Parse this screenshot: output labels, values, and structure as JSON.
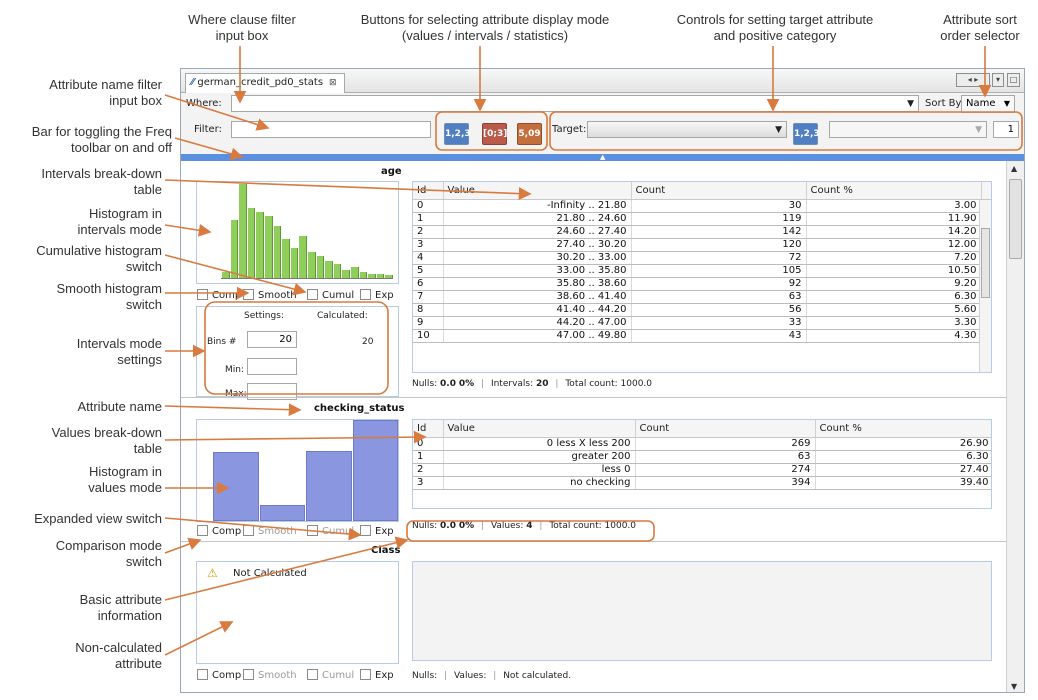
{
  "annotations_top": {
    "where_filter": "Where clause filter\ninput box",
    "mode_buttons": "Buttons for selecting attribute display mode\n(values / intervals / statistics)",
    "target_controls": "Controls for setting target attribute\nand positive category",
    "sort_selector": "Attribute sort\norder selector"
  },
  "annotations_left": {
    "name_filter": "Attribute name filter\ninput box",
    "freq_toggle": "Bar for toggling the Freq\ntoolbar on and off",
    "intervals_table": "Intervals break-down\ntable",
    "hist_intervals": "Histogram in\nintervals mode",
    "cumul_switch": "Cumulative histogram\nswitch",
    "smooth_switch": "Smooth histogram\nswitch",
    "intervals_settings": "Intervals mode\nsettings",
    "attr_name": "Attribute name",
    "values_table": "Values break-down\ntable",
    "hist_values": "Histogram in\nvalues mode",
    "expanded_switch": "Expanded view switch",
    "comparison_switch": "Comparison mode\nswitch",
    "basic_info": "Basic attribute\ninformation",
    "noncalc": "Non-calculated\nattribute"
  },
  "app": {
    "tab_title": "german_credit_pd0_stats",
    "where_label": "Where:",
    "filter_label": "Filter:",
    "sort_label": "Sort By:",
    "sort_value": "Name",
    "target_label": "Target:",
    "target_value": "",
    "positive_value": "1",
    "mode_values_icon": "1,2,3",
    "mode_intervals_icon": "[0;3]",
    "mode_stats_icon": "5,09",
    "target_mode_icon": "1,2,3"
  },
  "checkbox_labels": {
    "comp": "Comp",
    "smooth": "Smooth",
    "cumul": "Cumul",
    "exp": "Exp"
  },
  "age": {
    "name": "age",
    "columns": [
      "Id",
      "Value",
      "Count",
      "Count %"
    ],
    "rows": [
      [
        "0",
        "-Infinity  ..  21.80",
        "30",
        "3.00"
      ],
      [
        "1",
        "21.80  ..  24.60",
        "119",
        "11.90"
      ],
      [
        "2",
        "24.60  ..  27.40",
        "142",
        "14.20"
      ],
      [
        "3",
        "27.40  ..  30.20",
        "120",
        "12.00"
      ],
      [
        "4",
        "30.20  ..  33.00",
        "72",
        "7.20"
      ],
      [
        "5",
        "33.00  ..  35.80",
        "105",
        "10.50"
      ],
      [
        "6",
        "35.80  ..  38.60",
        "92",
        "9.20"
      ],
      [
        "7",
        "38.60  ..  41.40",
        "63",
        "6.30"
      ],
      [
        "8",
        "41.40  ..  44.20",
        "56",
        "5.60"
      ],
      [
        "9",
        "44.20  ..  47.00",
        "33",
        "3.30"
      ],
      [
        "10",
        "47.00  ..  49.80",
        "43",
        "4.30"
      ]
    ],
    "settings_label": "Settings:",
    "calculated_label": "Calculated:",
    "bins_label": "Bins #",
    "bins_setting": "20",
    "bins_calculated": "20",
    "min_label": "Min:",
    "max_label": "Max:",
    "status": {
      "nulls_label": "Nulls:",
      "nulls": "0.0",
      "nulls_pct": "0%",
      "intervals_label": "Intervals:",
      "intervals": "20",
      "total_label": "Total count:",
      "total": "1000.0"
    },
    "hist_fractions": [
      0.06,
      0.62,
      1.0,
      0.74,
      0.7,
      0.66,
      0.55,
      0.42,
      0.32,
      0.45,
      0.28,
      0.23,
      0.18,
      0.15,
      0.09,
      0.12,
      0.06,
      0.04,
      0.04,
      0.03
    ]
  },
  "checking_status": {
    "name": "checking_status",
    "columns": [
      "Id",
      "Value",
      "Count",
      "Count %"
    ],
    "rows": [
      [
        "0",
        "0 less X less 200",
        "269",
        "26.90"
      ],
      [
        "1",
        "greater 200",
        "63",
        "6.30"
      ],
      [
        "2",
        "less 0",
        "274",
        "27.40"
      ],
      [
        "3",
        "no checking",
        "394",
        "39.40"
      ]
    ],
    "status": {
      "nulls_label": "Nulls:",
      "nulls": "0.0",
      "nulls_pct": "0%",
      "values_label": "Values:",
      "values": "4",
      "total_label": "Total count:",
      "total": "1000.0"
    },
    "hist_values": [
      269,
      63,
      274,
      394
    ]
  },
  "class_attr": {
    "name": "Class",
    "not_calculated": "Not Calculated",
    "status": {
      "nulls_label": "Nulls:",
      "values_label": "Values:",
      "message": "Not calculated."
    }
  },
  "colors": {
    "accent_orange": "#d97a3f",
    "hist_green": "#8fce5a",
    "hist_blue": "#8a97e0",
    "freq_bar": "#5b8fe0"
  }
}
